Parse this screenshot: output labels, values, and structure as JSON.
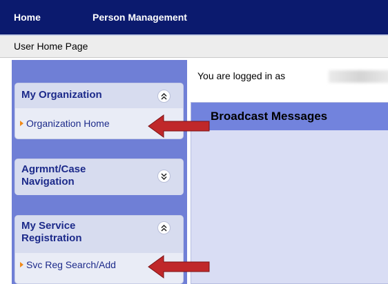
{
  "top_nav": {
    "items": [
      {
        "label": "Home"
      },
      {
        "label": "Person Management"
      }
    ]
  },
  "breadcrumb": {
    "label": "User Home Page"
  },
  "sidebar": {
    "panels": [
      {
        "title": "My Organization",
        "expanded": true,
        "link": "Organization Home",
        "toggle_icon": "chevrons-up-icon"
      },
      {
        "title_line1": "Agrmnt/Case",
        "title_line2": "Navigation",
        "expanded": false,
        "toggle_icon": "chevrons-down-icon"
      },
      {
        "title_line1": "My Service",
        "title_line2": "Registration",
        "expanded": true,
        "link": "Svc Reg Search/Add",
        "toggle_icon": "chevrons-up-icon"
      }
    ]
  },
  "main": {
    "login_prefix": "You are logged in as",
    "broadcast_title": "Broadcast Messages"
  },
  "colors": {
    "nav_bg": "#0b1a6e",
    "sidebar_bg": "#6f7fd6",
    "panel_bg": "#e9ecf6",
    "link_color": "#1c2a8a",
    "bullet": "#f08a1a",
    "broadcast_header": "#7283dd",
    "arrow": "#c0282a"
  }
}
